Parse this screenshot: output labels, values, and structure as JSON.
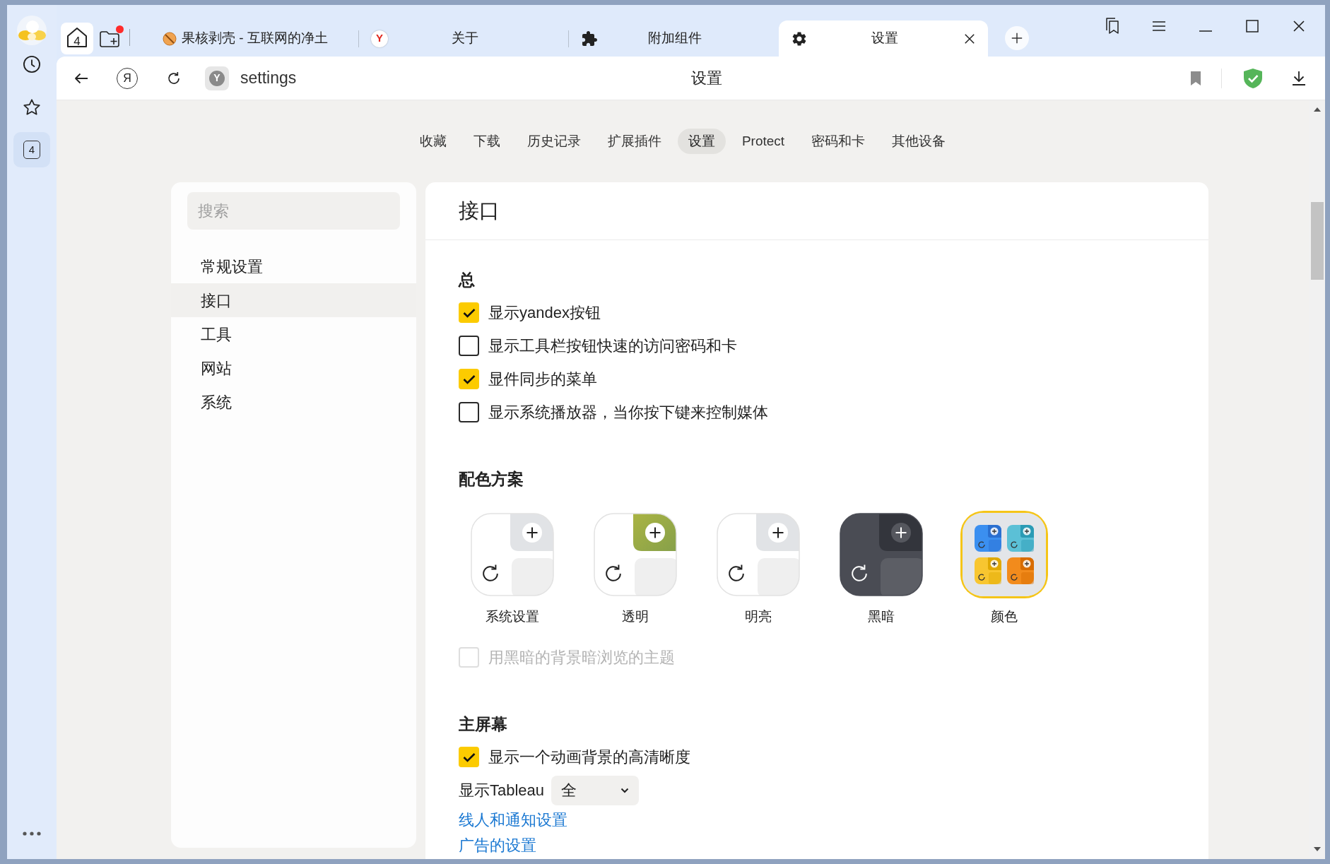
{
  "sidebar": {
    "tab_count": "4"
  },
  "tab_bar": {
    "home_count": "4",
    "collections_notification": true,
    "tabs": [
      {
        "title": "果核剥壳 - 互联网的净土",
        "kind": "site",
        "selected": false
      },
      {
        "title": "关于",
        "kind": "yandex",
        "icon_text": "Y",
        "selected": false
      },
      {
        "title": "附加组件",
        "kind": "extensions",
        "selected": false
      },
      {
        "title": "设置",
        "kind": "settings",
        "selected": true
      }
    ]
  },
  "address_bar": {
    "yandex_button": "Я",
    "site_badge": "Y",
    "url": "settings",
    "title": "设置"
  },
  "nav": [
    {
      "label": "收藏",
      "selected": false
    },
    {
      "label": "下载",
      "selected": false
    },
    {
      "label": "历史记录",
      "selected": false
    },
    {
      "label": "扩展插件",
      "selected": false
    },
    {
      "label": "设置",
      "selected": true
    },
    {
      "label": "Protect",
      "selected": false
    },
    {
      "label": "密码和卡",
      "selected": false
    },
    {
      "label": "其他设备",
      "selected": false
    }
  ],
  "settings_menu": {
    "search": {
      "placeholder": "搜索"
    },
    "items": [
      {
        "label": "常规设置",
        "selected": false
      },
      {
        "label": "接口",
        "selected": true
      },
      {
        "label": "工具",
        "selected": false
      },
      {
        "label": "网站",
        "selected": false
      },
      {
        "label": "系统",
        "selected": false
      }
    ]
  },
  "panel": {
    "title": "接口",
    "sections": [
      {
        "title": "总",
        "items": [
          {
            "kind": "checkbox",
            "label": "显示yandex按钮",
            "checked": true,
            "disabled": false
          },
          {
            "kind": "checkbox",
            "label": "显示工具栏按钮快速的访问密码和卡",
            "checked": false,
            "disabled": false
          },
          {
            "kind": "checkbox",
            "label": "显件同步的菜单",
            "checked": true,
            "disabled": false
          },
          {
            "kind": "checkbox",
            "label": "显示系统播放器，当你按下键来控制媒体",
            "checked": false,
            "disabled": false
          }
        ]
      },
      {
        "title": "配色方案",
        "themes": [
          {
            "label": "系统设置",
            "kind": "system",
            "selected": false
          },
          {
            "label": "透明",
            "kind": "transparent",
            "selected": false
          },
          {
            "label": "明亮",
            "kind": "light",
            "selected": false
          },
          {
            "label": "黑暗",
            "kind": "dark",
            "selected": false
          },
          {
            "label": "颜色",
            "kind": "colors",
            "selected": true
          }
        ],
        "items": [
          {
            "kind": "checkbox",
            "label": "用黑暗的背景暗浏览的主题",
            "checked": false,
            "disabled": true
          }
        ]
      },
      {
        "title": "主屏幕",
        "items": [
          {
            "kind": "checkbox",
            "label": "显示一个动画背景的高清晰度",
            "checked": true,
            "disabled": false
          },
          {
            "kind": "select",
            "label": "显示Tableau",
            "value": "全"
          },
          {
            "kind": "link",
            "label": "线人和通知设置"
          },
          {
            "kind": "link",
            "label": "广告的设置"
          }
        ]
      }
    ]
  }
}
